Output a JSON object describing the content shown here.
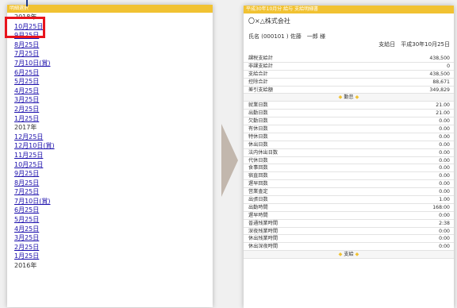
{
  "left": {
    "header": "明細選択",
    "years": [
      {
        "year": "2018年",
        "dates": [
          "10月25日",
          "9月25日",
          "8月25日",
          "7月25日",
          "7月10日(賞)",
          "6月25日",
          "5月25日",
          "4月25日",
          "3月25日",
          "2月25日",
          "1月25日"
        ]
      },
      {
        "year": "2017年",
        "dates": [
          "12月25日",
          "12月10日(賞)",
          "11月25日",
          "10月25日",
          "9月25日",
          "8月25日",
          "7月25日",
          "7月10日(賞)",
          "6月25日",
          "5月25日",
          "4月25日",
          "3月25日",
          "2月25日",
          "1月25日"
        ]
      },
      {
        "year": "2016年",
        "dates": []
      }
    ]
  },
  "right": {
    "header": "平成30年10月分 給与 支給明細書",
    "company": "〇×△株式会社",
    "employee": "氏名 (000101 ) 佐藤　一郎 様",
    "payday": "支給日　平成30年10月25日",
    "summary": [
      {
        "label": "課税支給計",
        "value": "438,500"
      },
      {
        "label": "非課支給計",
        "value": "0"
      },
      {
        "label": "支給合計",
        "value": "438,500"
      },
      {
        "label": "控除合計",
        "value": "88,671"
      },
      {
        "label": "差引支給額",
        "value": "349,829"
      }
    ],
    "attendance_title": "勤怠",
    "attendance": [
      {
        "label": "就業日数",
        "value": "21.00"
      },
      {
        "label": "出勤日数",
        "value": "21.00"
      },
      {
        "label": "欠勤日数",
        "value": "0.00"
      },
      {
        "label": "有休日数",
        "value": "0.00"
      },
      {
        "label": "特休日数",
        "value": "0.00"
      },
      {
        "label": "休出日数",
        "value": "0.00"
      },
      {
        "label": "法内休出日数",
        "value": "0.00"
      },
      {
        "label": "代休日数",
        "value": "0.00"
      },
      {
        "label": "食事回数",
        "value": "0.00"
      },
      {
        "label": "宿直回数",
        "value": "0.00"
      },
      {
        "label": "遅早回数",
        "value": "0.00"
      },
      {
        "label": "営業査定",
        "value": "0.00"
      },
      {
        "label": "出張日数",
        "value": "1.00"
      },
      {
        "label": "出勤時間",
        "value": "168:00"
      },
      {
        "label": "遅早時間",
        "value": "0:00"
      },
      {
        "label": "普通残業時間",
        "value": "2:38"
      },
      {
        "label": "深夜残業時間",
        "value": "0:00"
      },
      {
        "label": "休出残業時間",
        "value": "0:00"
      },
      {
        "label": "休出深夜時間",
        "value": "0:00"
      }
    ],
    "payment_title": "支給"
  }
}
